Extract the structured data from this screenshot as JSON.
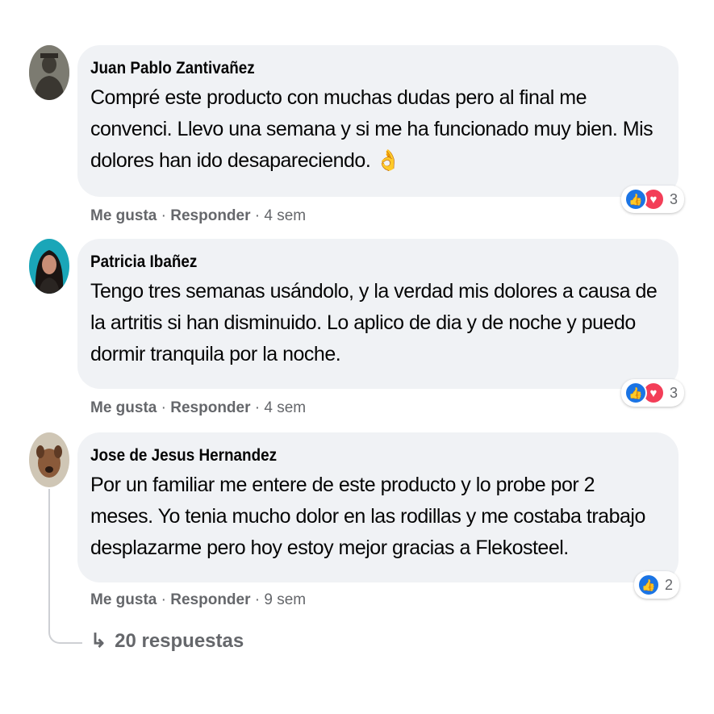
{
  "comments": [
    {
      "author": "Juan Pablo Zantivañez",
      "text": "Compré este producto con muchas dudas pero al final me convenci. Llevo una semana y si me ha funcionado muy bien. Mis dolores han ido desapareciendo.",
      "emoji": "👌",
      "like_label": "Me gusta",
      "reply_label": "Responder",
      "time": "4 sem",
      "reaction_count": "3",
      "reactions": [
        "like-icon",
        "love-icon"
      ]
    },
    {
      "author": "Patricia Ibañez",
      "text": "Tengo tres semanas usándolo, y la verdad mis dolores a causa de la artritis si han disminuido. Lo aplico de dia y de noche y puedo dormir tranquila por la noche.",
      "like_label": "Me gusta",
      "reply_label": "Responder",
      "time": "4 sem",
      "reaction_count": "3",
      "reactions": [
        "like-icon",
        "love-icon"
      ]
    },
    {
      "author": "Jose de Jesus Hernandez",
      "text": "Por un familiar me entere de este producto y lo probe por 2 meses. Yo tenia mucho dolor en las rodillas y me costaba trabajo desplazarme pero hoy estoy mejor gracias a Flekosteel.",
      "like_label": "Me gusta",
      "reply_label": "Responder",
      "time": "9 sem",
      "reaction_count": "2",
      "reactions": [
        "like-icon"
      ]
    }
  ],
  "replies_label": "20 respuestas",
  "colors": {
    "bubble": "#f0f2f5",
    "secondary_text": "#65676b",
    "like": "#1b74e4",
    "love": "#f33e58"
  }
}
